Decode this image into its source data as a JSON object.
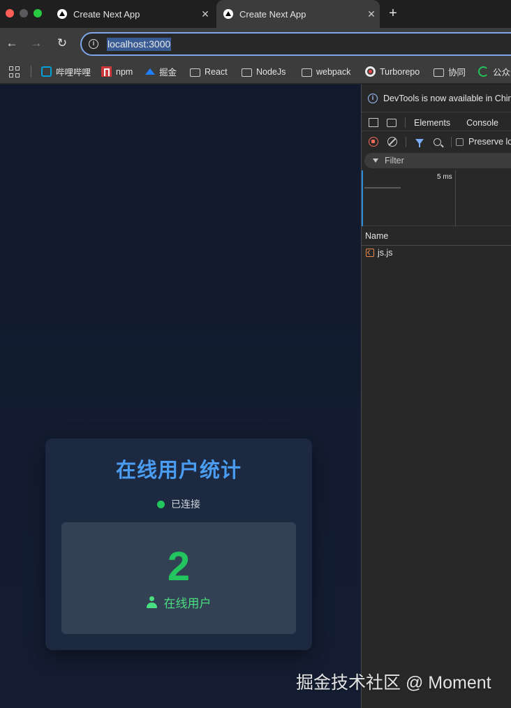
{
  "browser": {
    "tabs": [
      {
        "title": "Create Next App",
        "active": false
      },
      {
        "title": "Create Next App",
        "active": true
      }
    ],
    "new_tab": "+",
    "close_glyph": "✕",
    "url": "localhost:3000"
  },
  "bookmarks": [
    {
      "label": "哔哩哔哩",
      "icon": "bilibili-icon"
    },
    {
      "label": "npm",
      "icon": "npm-icon"
    },
    {
      "label": "掘金",
      "icon": "juejin-icon"
    },
    {
      "label": "React",
      "icon": "folder-icon"
    },
    {
      "label": "NodeJs",
      "icon": "folder-icon"
    },
    {
      "label": "webpack",
      "icon": "folder-icon"
    },
    {
      "label": "Turborepo",
      "icon": "turborepo-icon"
    },
    {
      "label": "协同",
      "icon": "folder-icon"
    },
    {
      "label": "公众号",
      "icon": "wechat-icon"
    }
  ],
  "card": {
    "title": "在线用户统计",
    "status": "已连接",
    "count": "2",
    "count_label": "在线用户",
    "accent": "#4a9cf0",
    "status_color": "#22c55e"
  },
  "devtools": {
    "banner": "DevTools is now available in Chinese",
    "tabs": [
      "Elements",
      "Console"
    ],
    "preserve_log": "Preserve log",
    "filter_placeholder": "Filter",
    "timeline_label": "5 ms",
    "column_name": "Name",
    "requests": [
      "js.js"
    ]
  },
  "watermark": "掘金技术社区 @ Moment"
}
